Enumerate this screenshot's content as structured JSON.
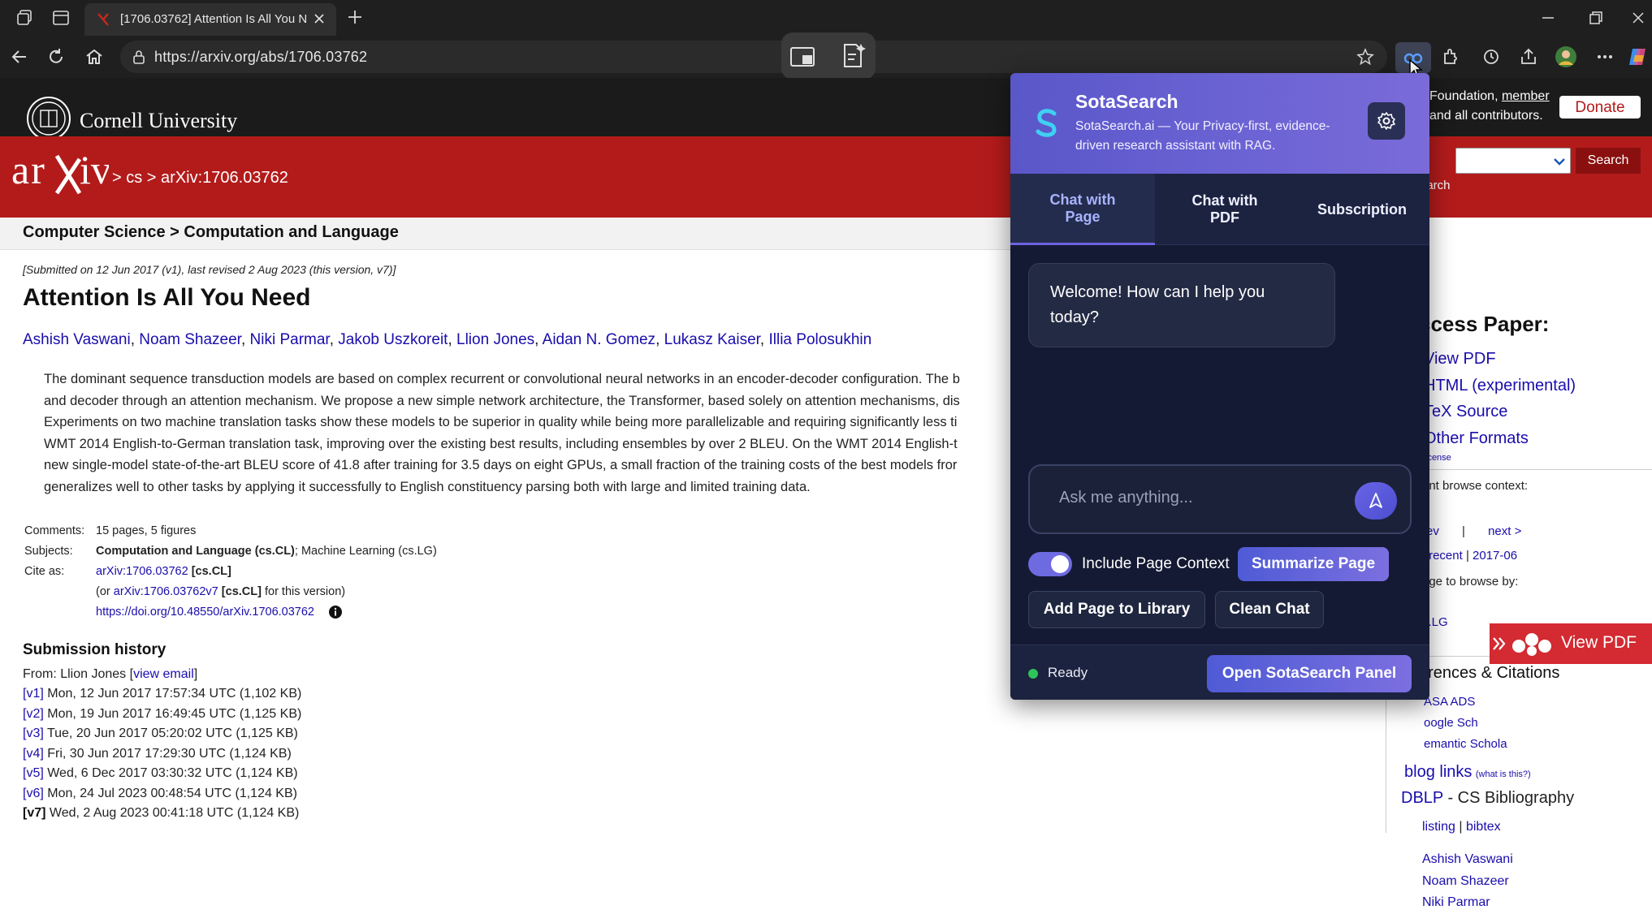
{
  "browser": {
    "tab_title": "[1706.03762] Attention Is All You Need",
    "url": "https://arxiv.org/abs/1706.03762"
  },
  "cornell": {
    "name": "Cornell University",
    "support_line1": "Foundation,",
    "support_member": "member",
    "support_line2": "and all contributors.",
    "donate": "Donate"
  },
  "arxiv": {
    "logo": "arXiv",
    "breadcrumb": "> cs > arXiv:1706.03762",
    "search_button": "Search",
    "search_help": "earch",
    "subject_bar": "Computer Science > Computation and Language"
  },
  "paper": {
    "submitted": "[Submitted on 12 Jun 2017 (v1), last revised 2 Aug 2023 (this version, v7)]",
    "title": "Attention Is All You Need",
    "authors": [
      "Ashish Vaswani",
      "Noam Shazeer",
      "Niki Parmar",
      "Jakob Uszkoreit",
      "Llion Jones",
      "Aidan N. Gomez",
      "Lukasz Kaiser",
      "Illia Polosukhin"
    ],
    "abstract_lines": [
      "The dominant sequence transduction models are based on complex recurrent or convolutional neural networks in an encoder-decoder configuration. The b",
      "and decoder through an attention mechanism. We propose a new simple network architecture, the Transformer, based solely on attention mechanisms, dis",
      "Experiments on two machine translation tasks show these models to be superior in quality while being more parallelizable and requiring significantly less ti",
      "WMT 2014 English-to-German translation task, improving over the existing best results, including ensembles by over 2 BLEU. On the WMT 2014 English-t",
      "new single-model state-of-the-art BLEU score of 41.8 after training for 3.5 days on eight GPUs, a small fraction of the training costs of the best models fror",
      "generalizes well to other tasks by applying it successfully to English constituency parsing both with large and limited training data."
    ],
    "comments_label": "Comments:",
    "comments": "15 pages, 5 figures",
    "subjects_label": "Subjects:",
    "subjects_main": "Computation and Language (cs.CL)",
    "subjects_rest": "; Machine Learning (cs.LG)",
    "cite_label": "Cite as:",
    "cite_id": "arXiv:1706.03762",
    "cite_tag": "[cs.CL]",
    "cite2_pre": "(or",
    "cite2_id": "arXiv:1706.03762v7",
    "cite2_tag": "[cs.CL]",
    "cite2_post": "for this version)",
    "doi": "https://doi.org/10.48550/arXiv.1706.03762",
    "history_title": "Submission history",
    "from_pre": "From: Llion Jones [",
    "from_link": "view email",
    "from_post": "]",
    "versions": [
      {
        "v": "[v1]",
        "d": "Mon, 12 Jun 2017 17:57:34 UTC (1,102 KB)"
      },
      {
        "v": "[v2]",
        "d": "Mon, 19 Jun 2017 16:49:45 UTC (1,125 KB)"
      },
      {
        "v": "[v3]",
        "d": "Tue, 20 Jun 2017 05:20:02 UTC (1,125 KB)"
      },
      {
        "v": "[v4]",
        "d": "Fri, 30 Jun 2017 17:29:30 UTC (1,124 KB)"
      },
      {
        "v": "[v5]",
        "d": "Wed, 6 Dec 2017 03:30:32 UTC (1,124 KB)"
      },
      {
        "v": "[v6]",
        "d": "Mon, 24 Jul 2023 00:48:54 UTC (1,124 KB)"
      },
      {
        "v": "[v7]",
        "d": "Wed, 2 Aug 2023 00:41:18 UTC (1,124 KB)"
      }
    ]
  },
  "sidebar": {
    "access_title": "ccess Paper:",
    "access_links": [
      "View PDF",
      "HTML (experimental)",
      "TeX Source",
      "Other Formats"
    ],
    "license": "icense",
    "browse_context": "ent browse context:",
    "context_value": "L",
    "prev": "rev",
    "sep": "|",
    "next": "next >",
    "new_label": "|",
    "recent": "recent",
    "date": "2017-06",
    "change_browse": "nge to browse by:",
    "cs_lg": "s.LG",
    "refs_title": "erences & Citations",
    "refs": [
      "ASA ADS",
      "oogle Sch",
      "emantic Schola"
    ],
    "blog_links": "blog links",
    "blog_what": "(what is this?)",
    "dblp": "DBLP",
    "dblp_rest": " - CS Bibliography",
    "listing": "listing",
    "bibtex": "bibtex",
    "dblp_authors": [
      "Ashish Vaswani",
      "Noam Shazeer",
      "Niki Parmar"
    ],
    "view_pdf_float": "View PDF"
  },
  "popup": {
    "name": "SotaSearch",
    "tagline": "SotaSearch.ai — Your Privacy-first, evidence-driven research assistant with RAG.",
    "tabs": [
      "Chat with Page",
      "Chat with PDF",
      "Subscription"
    ],
    "welcome": "Welcome! How can I help you today?",
    "input_placeholder": "Ask me anything...",
    "toggle_label": "Include Page Context",
    "summarize": "Summarize Page",
    "add_library": "Add Page to Library",
    "clean_chat": "Clean Chat",
    "status": "Ready",
    "open_panel": "Open SotaSearch Panel"
  }
}
